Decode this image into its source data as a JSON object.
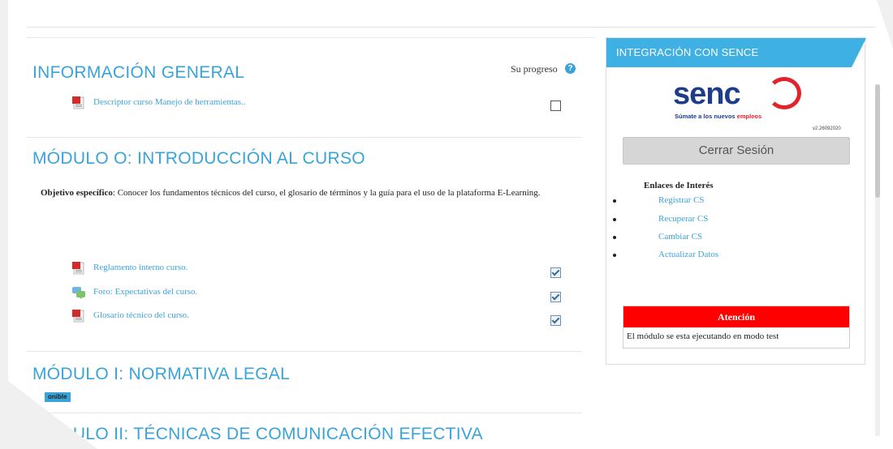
{
  "main": {
    "sections": [
      {
        "title": "INFORMACIÓN GENERAL"
      },
      {
        "title": "MÓDULO O: INTRODUCCIÓN AL CURSO"
      },
      {
        "title": "MÓDULO I: NORMATIVA LEGAL"
      },
      {
        "title": "MÓDULO II: TÉCNICAS DE COMUNICACIÓN EFECTIVA"
      }
    ],
    "progress_label": "Su progreso",
    "general_activity": {
      "label": "Descriptor curso Manejo de herramientas..",
      "icon": "pdf-icon",
      "completed": false
    },
    "objective_label": "Objetivo específico",
    "objective_text": ": Conocer los fundamentos técnicos del curso, el glosario de términos y la guía para el uso de la plataforma E-Learning.",
    "module0_activities": [
      {
        "label": "Reglamento interno curso.",
        "icon": "pdf-icon",
        "completed": true
      },
      {
        "label": "Foro: Expectativas del curso.",
        "icon": "forum-icon",
        "completed": true
      },
      {
        "label": "Glosario técnico del curso.",
        "icon": "pdf-icon",
        "completed": true
      }
    ],
    "badge": "onible"
  },
  "sidebar": {
    "header": "INTEGRACIÓN CON SENCE",
    "logo_word": "senc",
    "logo_tag_prefix": "Súmate a los nuevos ",
    "logo_tag_accent": "empleos",
    "version": "v2.26092020",
    "logout_label": "Cerrar Sesión",
    "links_title": "Enlaces de Interés",
    "links": [
      "Registrar CS",
      "Recuperar CS",
      "Cambiar CS",
      "Actualizar Datos"
    ],
    "alert_title": "Atención",
    "alert_message": "El módulo se esta ejecutando en modo test"
  },
  "colors": {
    "accent": "#3aa3d9",
    "header_blue": "#3fb0e3",
    "alert_red": "#ff0000",
    "sence_navy": "#1d3c8a",
    "sence_red": "#e3232b"
  }
}
